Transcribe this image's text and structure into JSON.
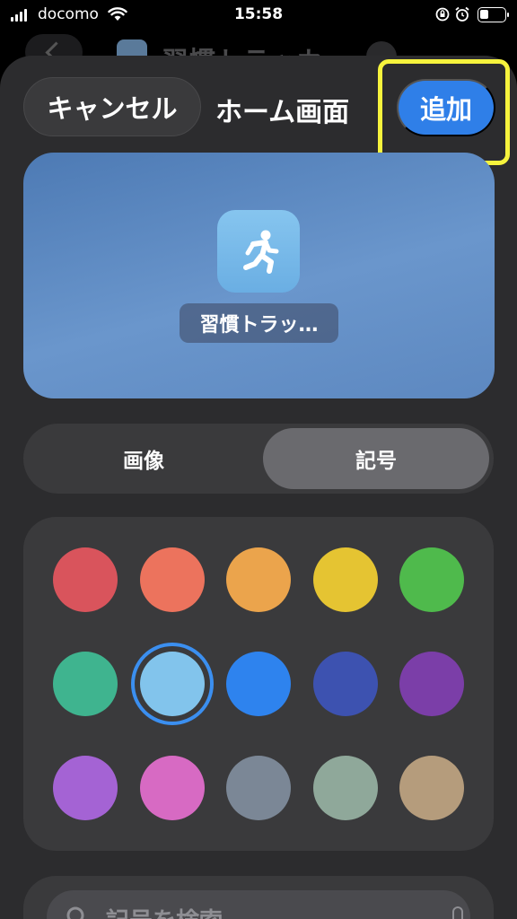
{
  "status_bar": {
    "carrier": "docomo",
    "time": "15:58"
  },
  "background_app": {
    "title": "習慣トラッカー"
  },
  "sheet": {
    "cancel_label": "キャンセル",
    "title": "ホーム画面",
    "add_label": "追加",
    "highlight_color": "#f6f33d"
  },
  "preview": {
    "icon": "running-person-icon",
    "app_label": "習慣トラッ…"
  },
  "segmented": {
    "image_label": "画像",
    "symbol_label": "記号",
    "selected": "記号"
  },
  "colors": [
    {
      "name": "red",
      "hex": "#d9545c"
    },
    {
      "name": "coral",
      "hex": "#ec735d"
    },
    {
      "name": "orange",
      "hex": "#eba44c"
    },
    {
      "name": "yellow",
      "hex": "#e5c432"
    },
    {
      "name": "green",
      "hex": "#4fba4c"
    },
    {
      "name": "teal",
      "hex": "#3fb48f"
    },
    {
      "name": "light-blue",
      "hex": "#82c4ec",
      "selected": true
    },
    {
      "name": "blue",
      "hex": "#2e83ee"
    },
    {
      "name": "indigo",
      "hex": "#3d52b0"
    },
    {
      "name": "purple",
      "hex": "#7b3ea8"
    },
    {
      "name": "violet",
      "hex": "#a463d4"
    },
    {
      "name": "pink",
      "hex": "#d76ac3"
    },
    {
      "name": "gray",
      "hex": "#7b8796"
    },
    {
      "name": "sage",
      "hex": "#8fa89a"
    },
    {
      "name": "tan",
      "hex": "#b59c7c"
    }
  ],
  "search": {
    "placeholder": "記号を検索"
  }
}
